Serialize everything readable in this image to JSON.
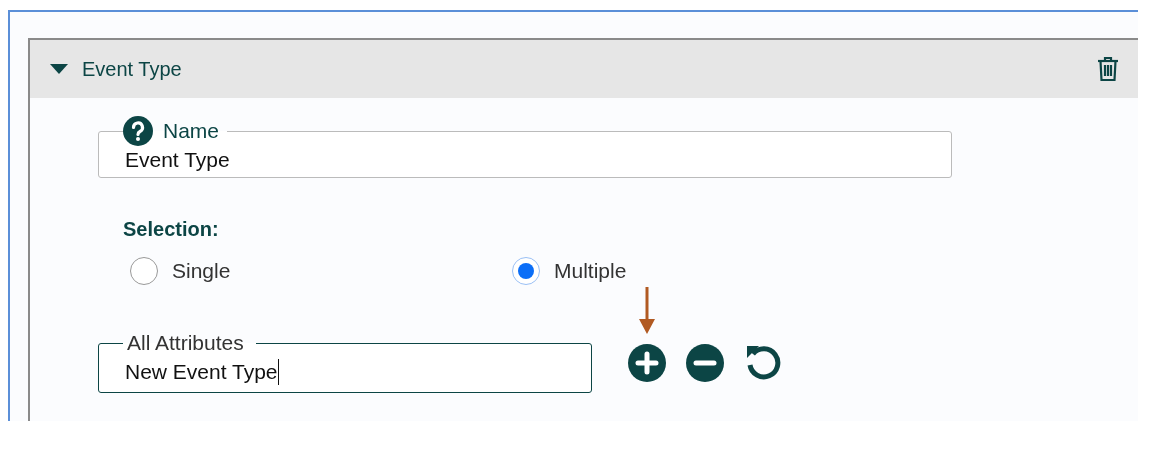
{
  "section": {
    "title": "Event Type",
    "expanded": true
  },
  "name_field": {
    "label": "Name",
    "value": "Event Type"
  },
  "selection": {
    "label": "Selection:",
    "options": [
      {
        "label": "Single",
        "selected": false
      },
      {
        "label": "Multiple",
        "selected": true
      }
    ]
  },
  "attributes_field": {
    "label": "All Attributes",
    "value": "New Event Type",
    "focused": true
  }
}
